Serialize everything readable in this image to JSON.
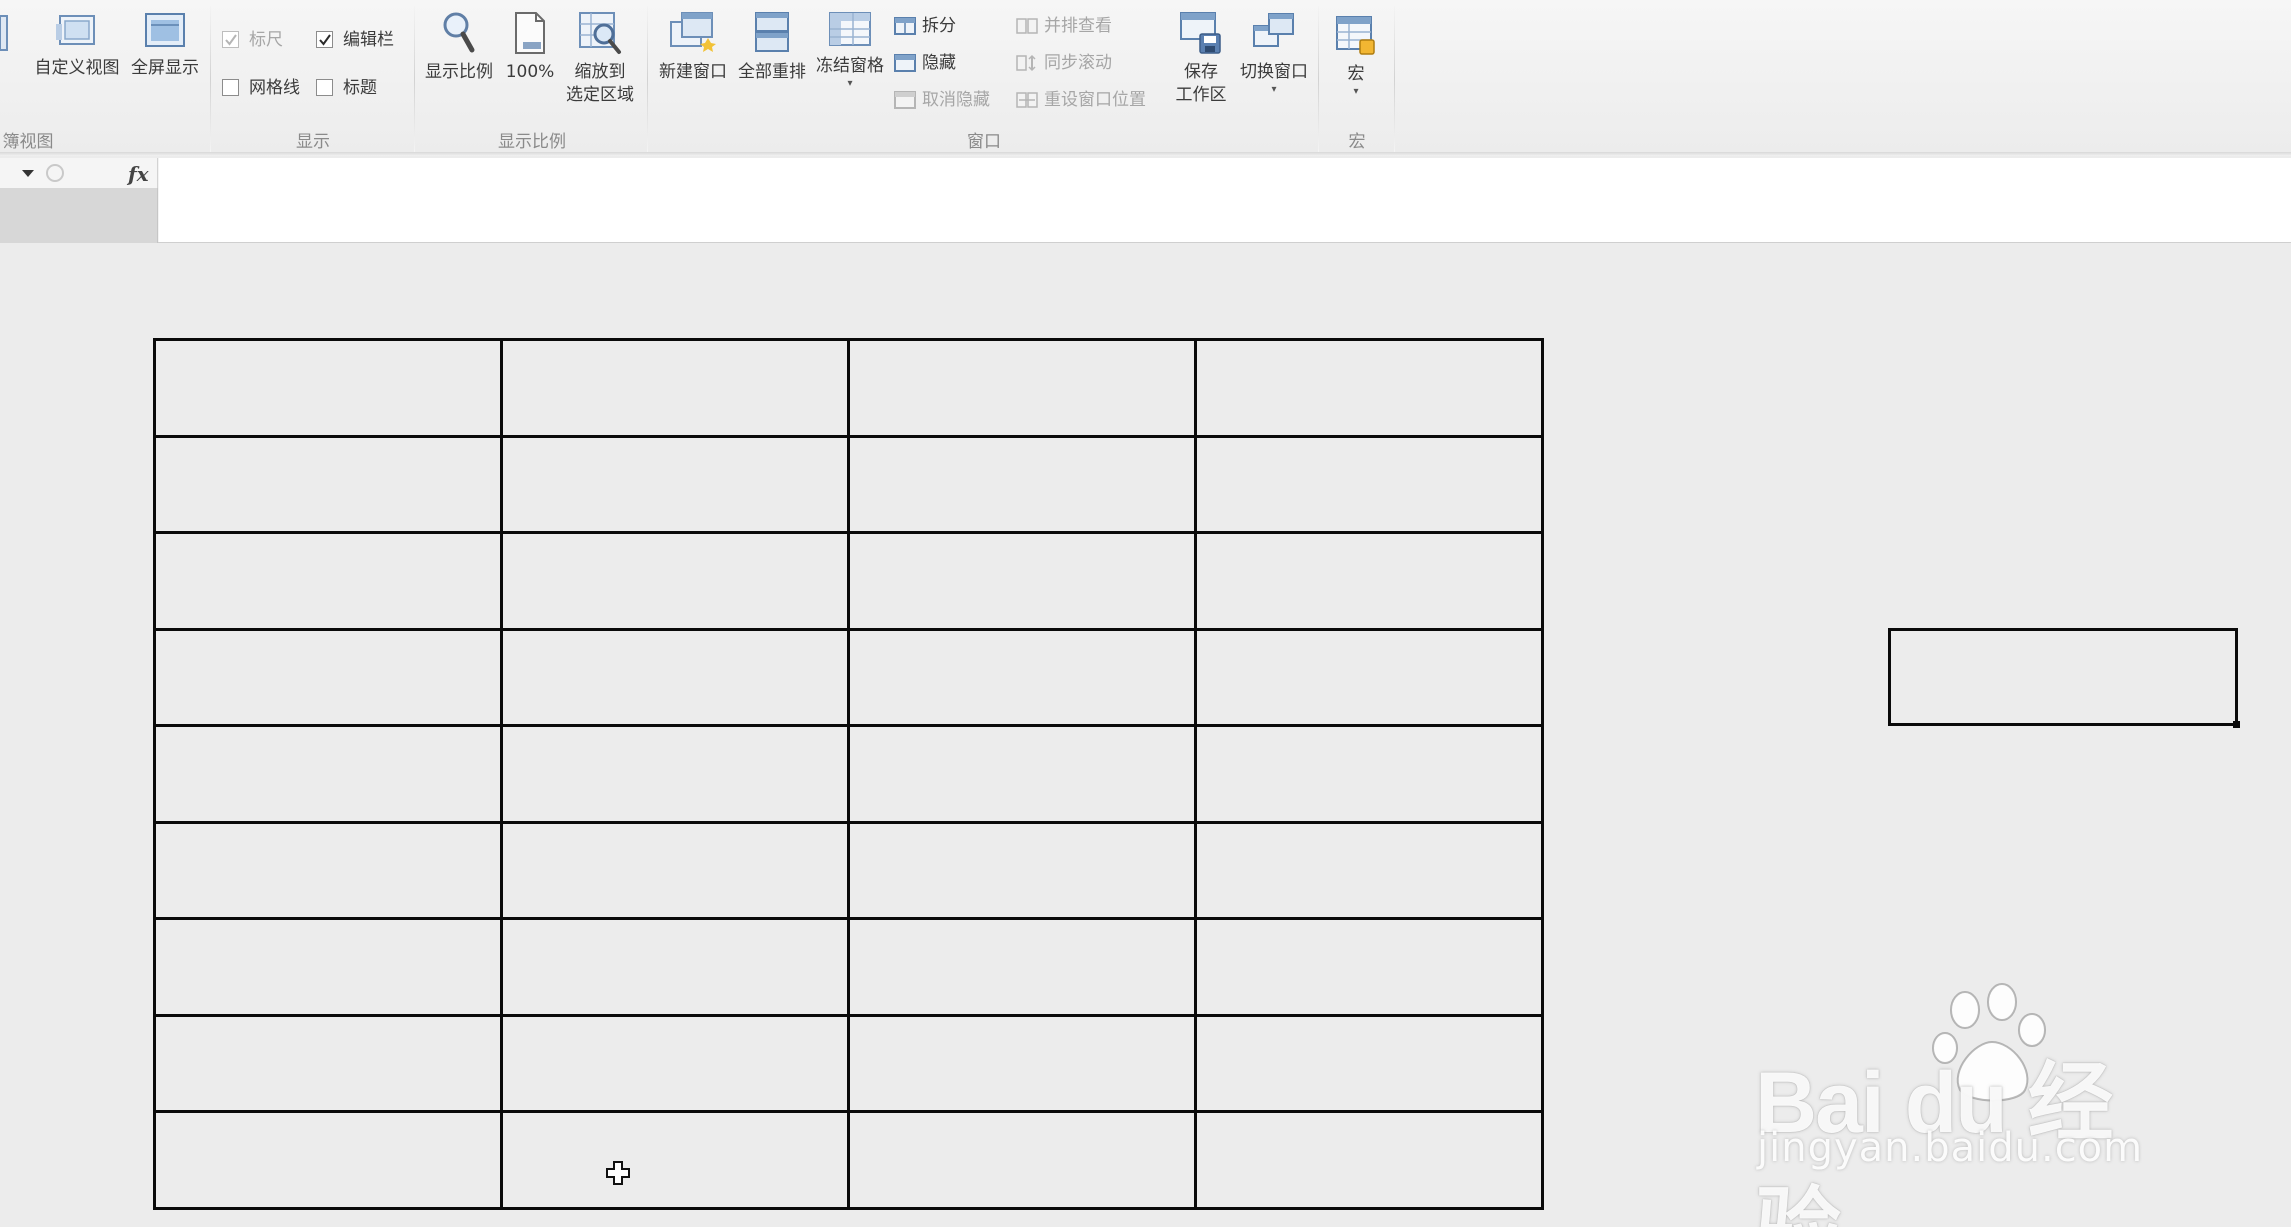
{
  "ribbon": {
    "workbook_views": {
      "custom_view": "自定义视图",
      "full_screen": "全屏显示",
      "group_label": "簿视图"
    },
    "show": {
      "ruler": "标尺",
      "formula_bar": "编辑栏",
      "gridlines": "网格线",
      "headings": "标题",
      "group_label": "显示"
    },
    "zoom": {
      "zoom": "显示比例",
      "zoom_100": "100%",
      "zoom_to_selection_line1": "缩放到",
      "zoom_to_selection_line2": "选定区域",
      "group_label": "显示比例"
    },
    "window": {
      "new_window": "新建窗口",
      "arrange_all": "全部重排",
      "freeze_panes": "冻结窗格",
      "split": "拆分",
      "hide": "隐藏",
      "unhide": "取消隐藏",
      "view_side_by_side": "并排查看",
      "synchronous_scrolling": "同步滚动",
      "reset_window_position": "重设窗口位置",
      "save_workspace_line1": "保存",
      "save_workspace_line2": "工作区",
      "switch_windows": "切换窗口",
      "group_label": "窗口"
    },
    "macros": {
      "macros": "宏",
      "group_label": "宏"
    }
  },
  "formula_bar": {
    "fx_label": "fx"
  },
  "sheet": {
    "table_rows": 9,
    "table_cols": 4
  },
  "watermark": {
    "logo_text": "Bai  du 经验",
    "url": "jingyan.baidu.com"
  },
  "colors": {
    "sheet_background": "#ececec",
    "border": "#0a0a0a",
    "ribbon_background": "#f2f2f2"
  }
}
